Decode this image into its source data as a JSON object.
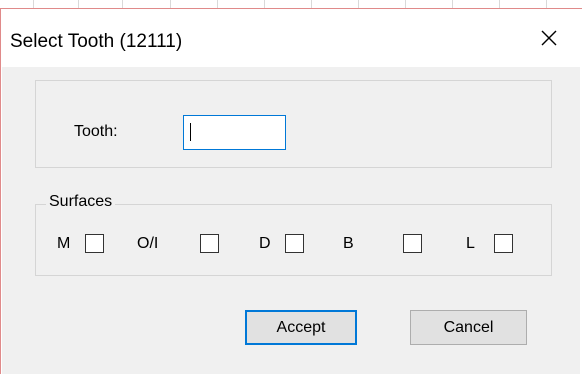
{
  "window": {
    "title": "Select Tooth (12111)"
  },
  "icons": {
    "close": "close-icon"
  },
  "tooth": {
    "label": "Tooth:",
    "value": ""
  },
  "surfaces": {
    "legend": "Surfaces",
    "items": [
      {
        "label": "M",
        "checked": false
      },
      {
        "label": "O/I",
        "checked": false
      },
      {
        "label": "D",
        "checked": false
      },
      {
        "label": "B",
        "checked": false
      },
      {
        "label": "L",
        "checked": false
      }
    ]
  },
  "buttons": {
    "accept": "Accept",
    "cancel": "Cancel"
  },
  "colors": {
    "accent": "#0078d7",
    "dialog_bg": "#f0f0f0",
    "title_bg": "#ffffff"
  }
}
